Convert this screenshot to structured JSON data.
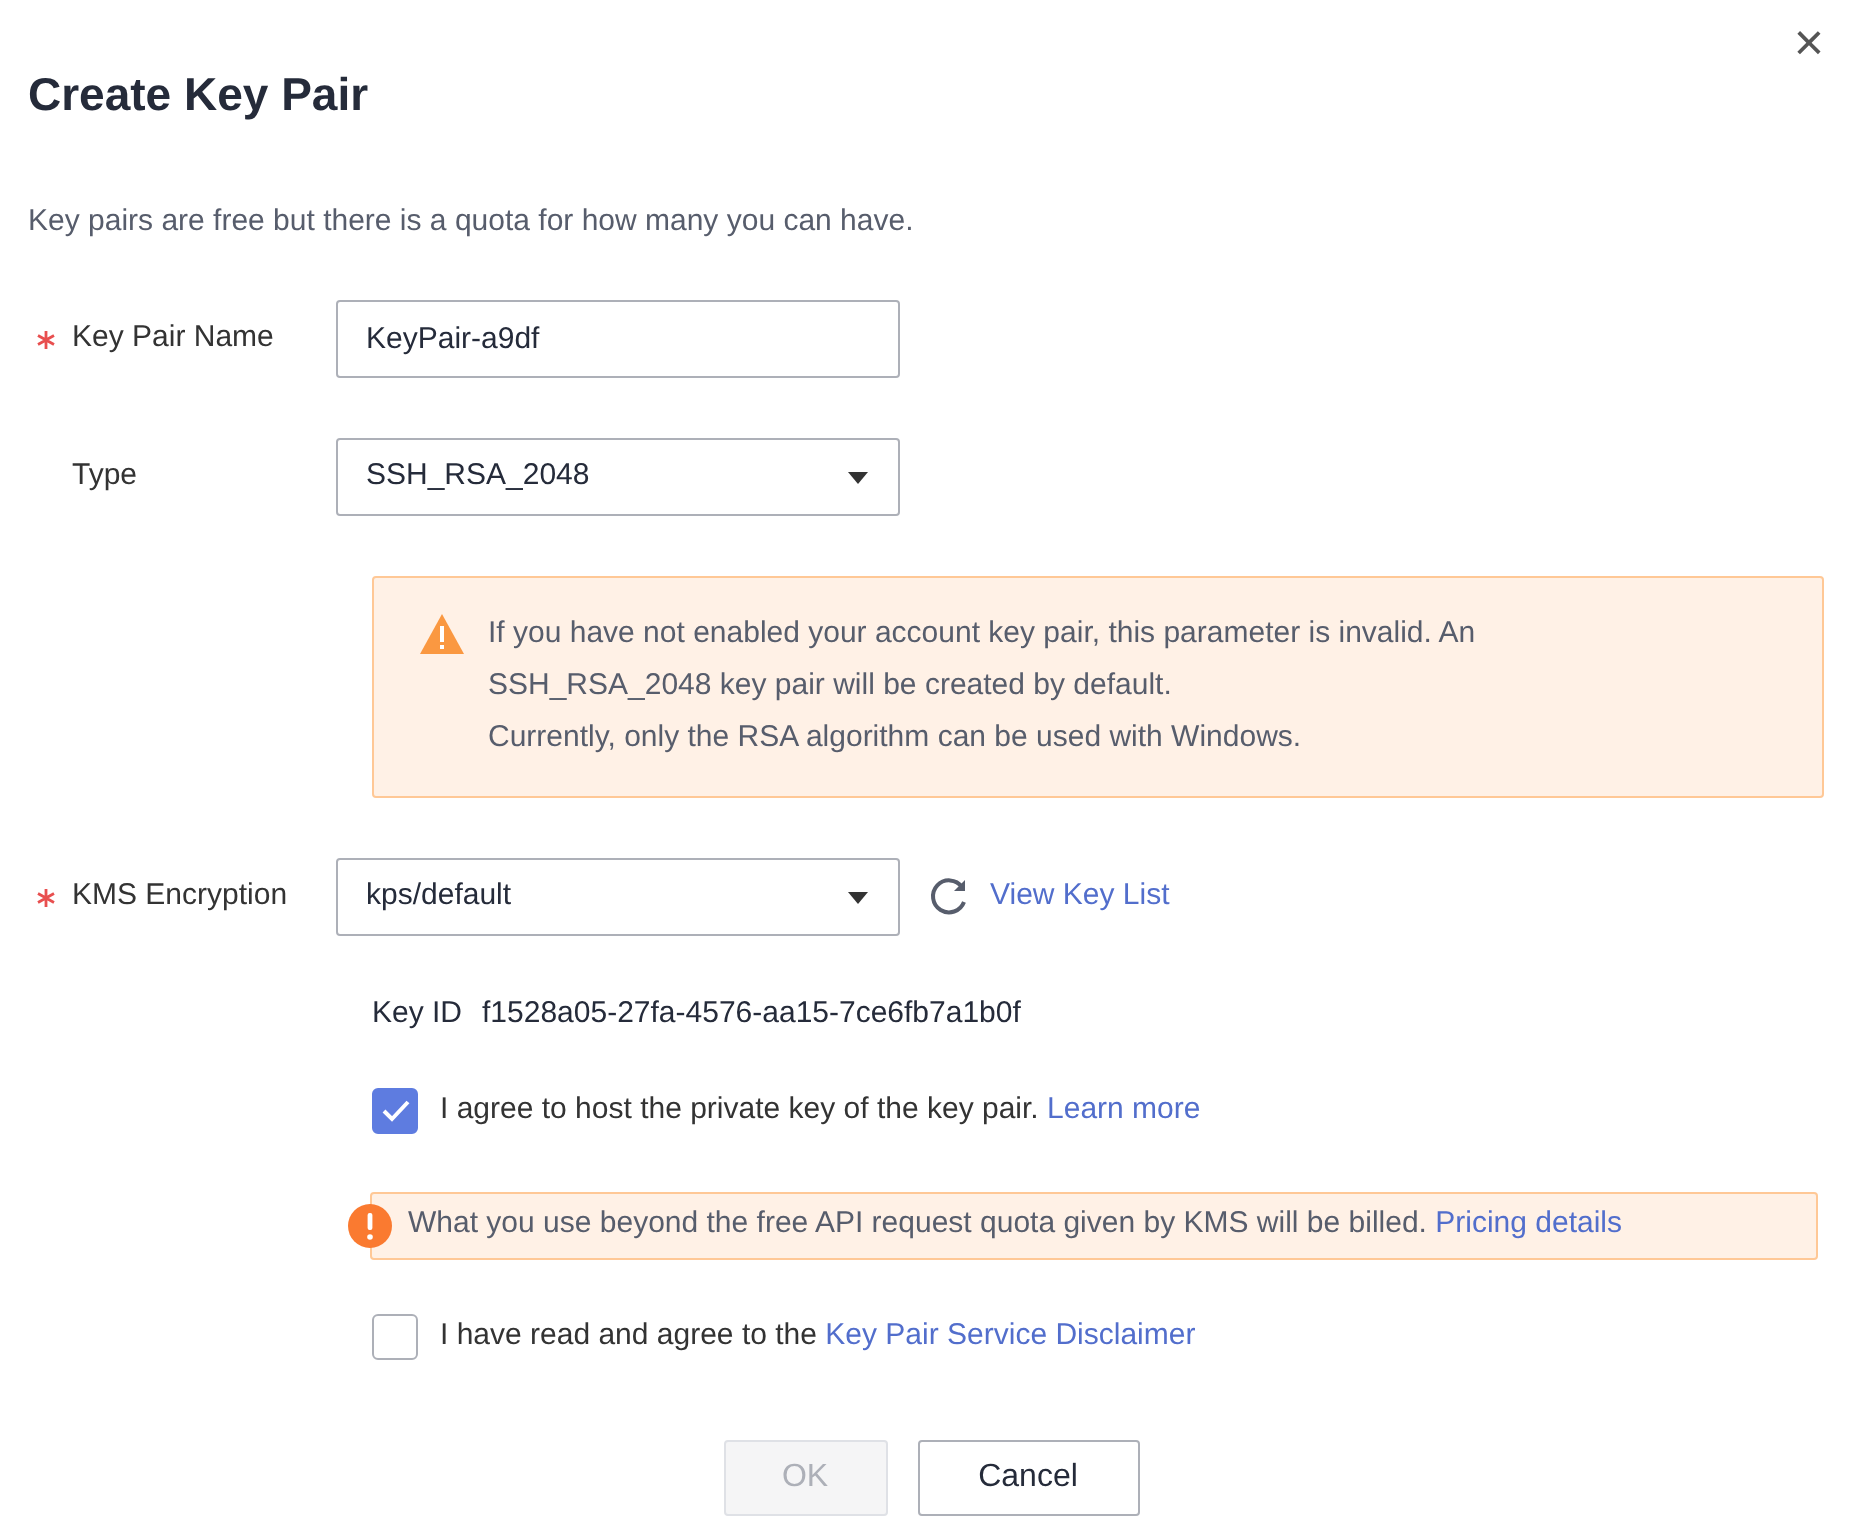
{
  "dialog": {
    "title": "Create Key Pair",
    "close": "×",
    "description": "Key pairs are free but there is a quota for how many you can have."
  },
  "name_field": {
    "label": "Key Pair Name",
    "required": true,
    "value": "KeyPair-a9df"
  },
  "type_field": {
    "label": "Type",
    "required": false,
    "value": "SSH_RSA_2048"
  },
  "type_notice": {
    "lines": [
      "If you have not enabled your account key pair, this parameter is invalid. An SSH_RSA_2048 key pair will be created by default.",
      "Currently, only the RSA algorithm can be used with Windows."
    ]
  },
  "kms_field": {
    "label": "KMS Encryption",
    "required": true,
    "value": "kps/default",
    "link": "View Key List"
  },
  "key_id": {
    "label": "Key ID",
    "value": "f1528a05-27fa-4576-aa15-7ce6fb7a1b0f"
  },
  "host_agreement": {
    "checked": true,
    "text": "I agree to host the private key of the key pair.",
    "link": "Learn more"
  },
  "billing_notice": {
    "text": "What you use beyond the free API request quota given by KMS will be billed.",
    "link": "Pricing details"
  },
  "disclaimer_agreement": {
    "checked": false,
    "text": "I have read and agree to the",
    "link": "Key Pair Service Disclaimer"
  },
  "buttons": [
    {
      "label": "OK",
      "disabled": true
    },
    {
      "label": "Cancel",
      "disabled": false
    }
  ]
}
